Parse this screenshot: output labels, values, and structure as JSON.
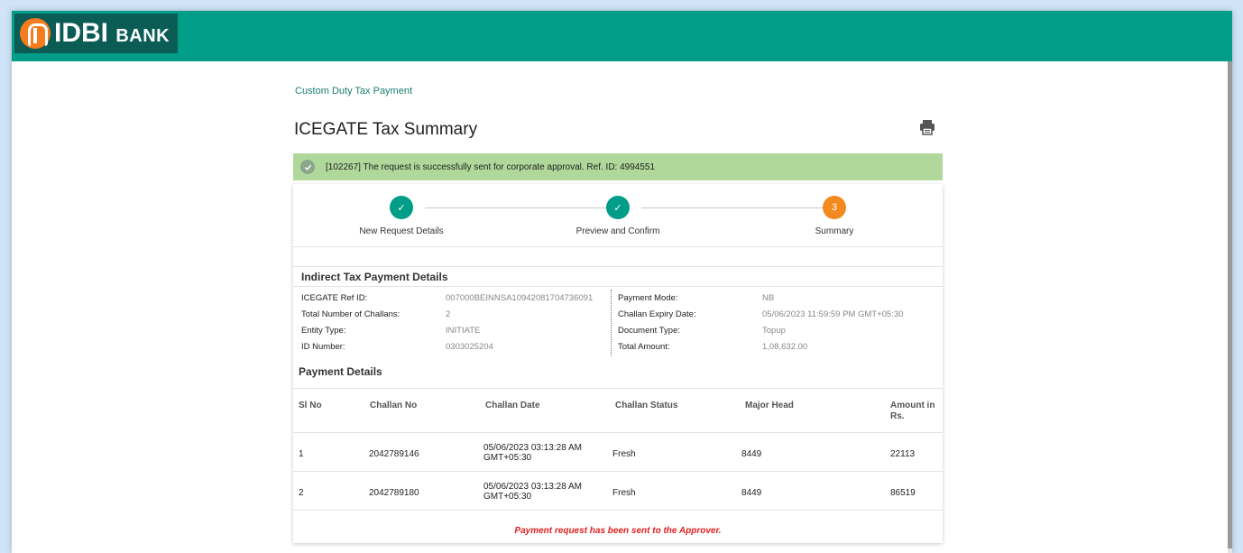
{
  "brand": {
    "name": "IDBI",
    "suffix": "BANK"
  },
  "breadcrumb": "Custom Duty Tax Payment",
  "page_title": "ICEGATE Tax Summary",
  "alert": {
    "message": "[102267] The request is successfully sent for corporate approval. Ref. ID: 4994551"
  },
  "stepper": {
    "steps": [
      {
        "label": "New Request Details",
        "state": "done",
        "mark": "✓"
      },
      {
        "label": "Preview and Confirm",
        "state": "done",
        "mark": "✓"
      },
      {
        "label": "Summary",
        "state": "active",
        "mark": "3"
      }
    ]
  },
  "indirect_tax": {
    "title": "Indirect Tax Payment Details",
    "left": [
      {
        "label": "ICEGATE Ref ID:",
        "value": "007000BEINNSA10942081704736091"
      },
      {
        "label": "Total Number of Challans:",
        "value": "2"
      },
      {
        "label": "Entity Type:",
        "value": "INITIATE"
      },
      {
        "label": "ID Number:",
        "value": "0303025204"
      }
    ],
    "right": [
      {
        "label": "Payment Mode:",
        "value": "NB"
      },
      {
        "label": "Challan Expiry Date:",
        "value": "05/06/2023 11:59:59 PM GMT+05:30"
      },
      {
        "label": "Document Type:",
        "value": "Topup"
      },
      {
        "label": "Total Amount:",
        "value": "1,08,632.00"
      }
    ]
  },
  "payment_details": {
    "title": "Payment Details",
    "columns": [
      "Sl No",
      "Challan No",
      "Challan Date",
      "Challan Status",
      "Major Head",
      "Amount in Rs."
    ],
    "rows": [
      [
        "1",
        "2042789146",
        "05/06/2023 03:13:28 AM GMT+05:30",
        "Fresh",
        "8449",
        "22113"
      ],
      [
        "2",
        "2042789180",
        "05/06/2023 03:13:28 AM GMT+05:30",
        "Fresh",
        "8449",
        "86519"
      ]
    ]
  },
  "footer_note": "Payment request has been sent to the Approver.",
  "colors": {
    "brand": "#009d88",
    "brand_dark": "#0a5c55",
    "accent": "#f28a1f",
    "success_bg": "#b1d89b",
    "alert_text": "#e11f1f"
  }
}
